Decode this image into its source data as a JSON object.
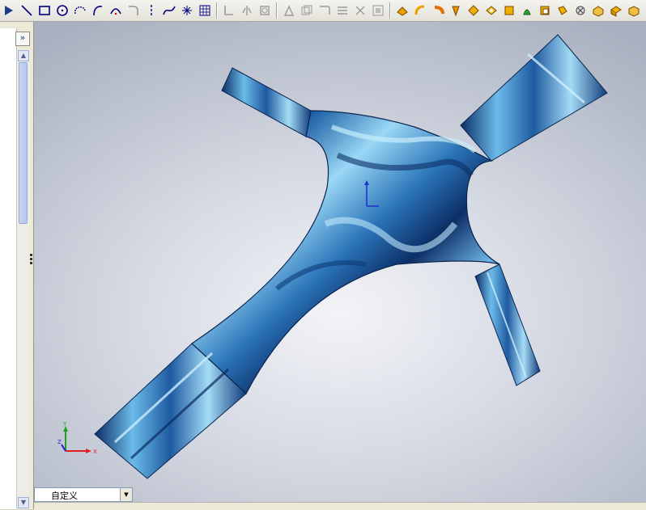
{
  "toolbar": {
    "icons": [
      "arrow",
      "line",
      "rectangle",
      "circle",
      "centerpoint-arc",
      "tangent-arc",
      "three-point-arc",
      "fillet",
      "centerline",
      "spline",
      "point",
      "grid",
      "linear-pattern",
      "mirror",
      "offset",
      "dimension",
      "trim",
      "extend",
      "move",
      "convert",
      "add-relation",
      "extrude",
      "revolve",
      "sweep",
      "loft",
      "boss",
      "cut",
      "hole",
      "fillet-feature",
      "chamfer",
      "shell",
      "draft",
      "rib",
      "dome",
      "cube"
    ]
  },
  "sidebar": {
    "expand_label": "»"
  },
  "view": {
    "orientation_label": "自定义",
    "triad": {
      "y_label": "Y",
      "x_label": "X",
      "z_label": "Z"
    }
  },
  "colors": {
    "model_light": "#8ecff3",
    "model_mid": "#3f86c6",
    "model_dark": "#0c2f66",
    "triad_x": "#e02020",
    "triad_y": "#20a020",
    "triad_z": "#2020e0"
  }
}
